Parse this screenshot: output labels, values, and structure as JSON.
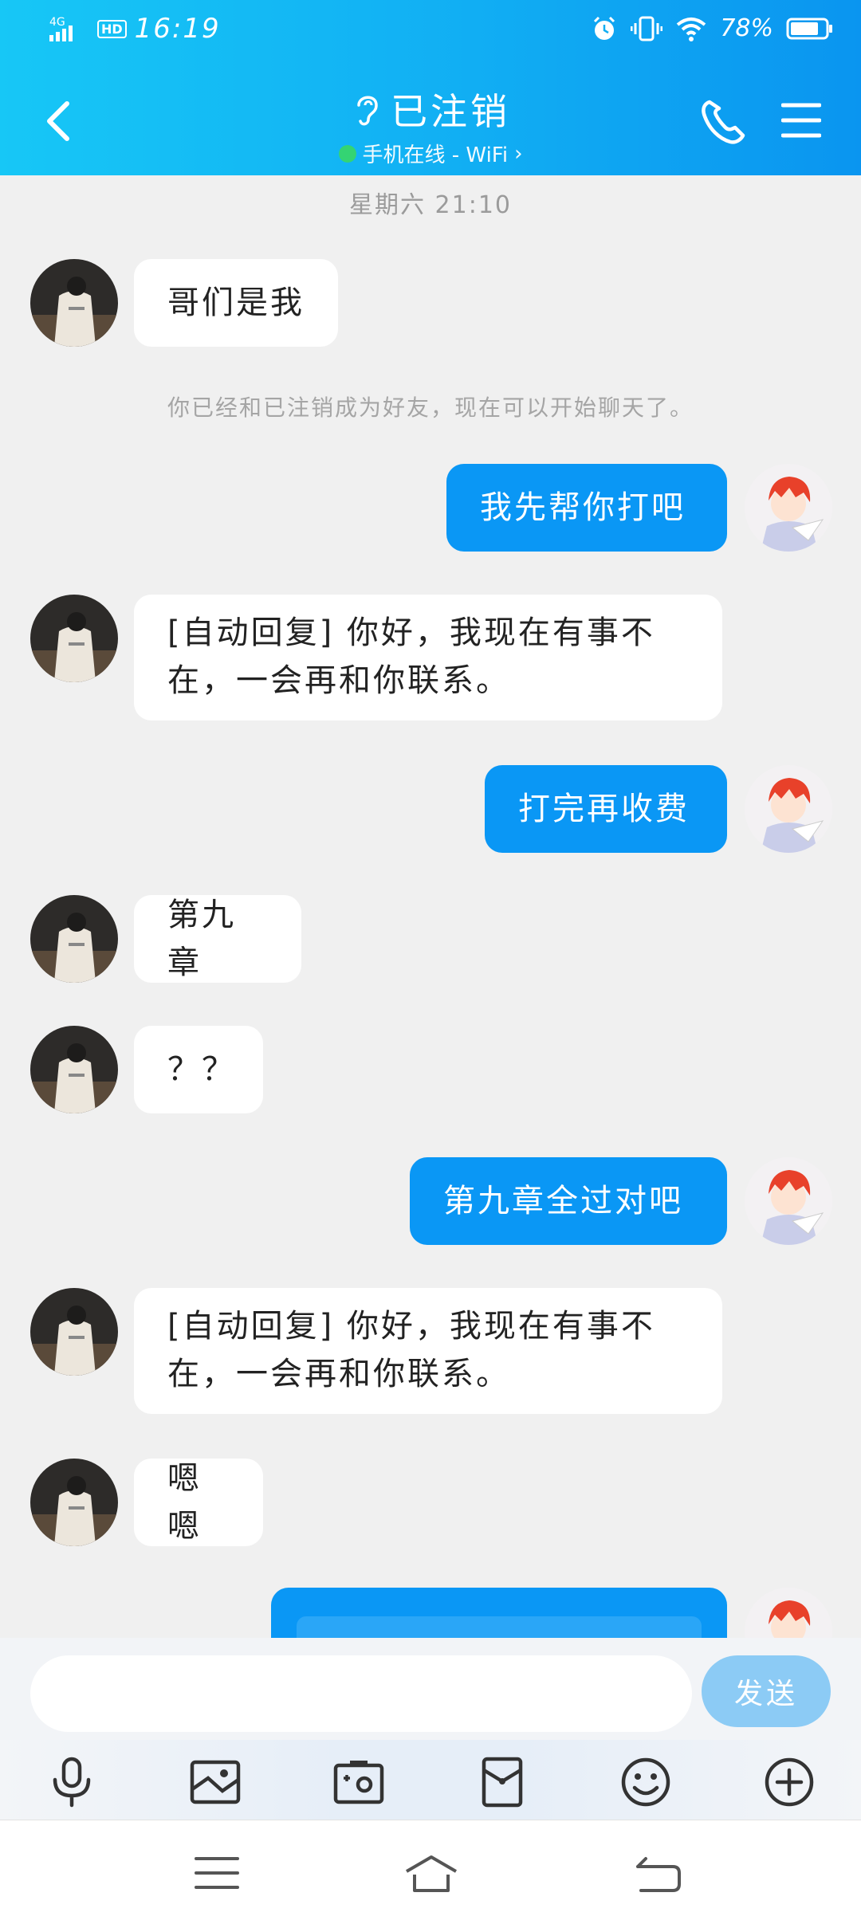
{
  "status_bar": {
    "network": "4G",
    "hd": "HD",
    "time": "16:19",
    "battery": "78%"
  },
  "header": {
    "title": "已注销",
    "subtitle": "手机在线 - WiFi",
    "subtitle_arrow": "›"
  },
  "chat": {
    "timestamp": "星期六 21:10",
    "system_message": "你已经和已注销成为好友，现在可以开始聊天了。",
    "messages": [
      {
        "from": "them",
        "text": "哥们是我"
      },
      {
        "from": "me",
        "text": "我先帮你打吧"
      },
      {
        "from": "them",
        "text": "[自动回复] 你好，我现在有事不在，一会再和你联系。"
      },
      {
        "from": "me",
        "text": "打完再收费"
      },
      {
        "from": "them",
        "text": "第九章"
      },
      {
        "from": "them",
        "text": "？？"
      },
      {
        "from": "me",
        "text": "第九章全过对吧"
      },
      {
        "from": "them",
        "text": "[自动回复] 你好，我现在有事不在，一会再和你联系。"
      },
      {
        "from": "them",
        "text": "嗯嗯"
      }
    ]
  },
  "input": {
    "placeholder": "",
    "send_label": "发送"
  },
  "toolbar": [
    "microphone-icon",
    "image-icon",
    "camera-icon",
    "red-packet-icon",
    "emoji-icon",
    "plus-icon"
  ],
  "colors": {
    "header_start": "#17c7f6",
    "header_end": "#0a95f0",
    "my_bubble": "#0a97f5",
    "send_button": "#8ccbf5",
    "online": "#36d66d"
  }
}
